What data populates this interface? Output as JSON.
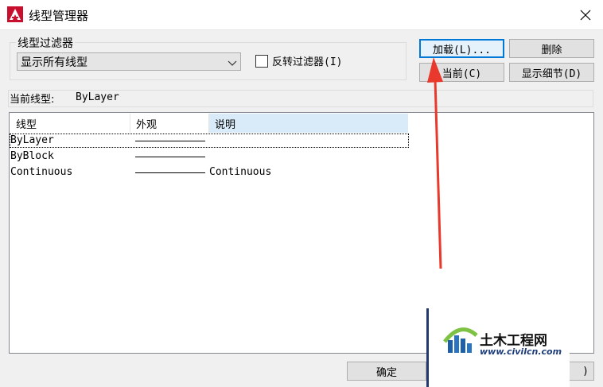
{
  "window": {
    "title": "线型管理器"
  },
  "filter": {
    "group_label": "线型过滤器",
    "selected": "显示所有线型",
    "invert_label": "反转过滤器(I)",
    "invert_checked": false
  },
  "buttons": {
    "load": "加载(L)...",
    "delete": "删除",
    "current": "当前(C)",
    "details": "显示细节(D)",
    "ok": "确定",
    "help_partial": ")"
  },
  "current_linetype": {
    "label": "当前线型:",
    "value": "ByLayer"
  },
  "table": {
    "columns": [
      "线型",
      "外观",
      "说明"
    ],
    "rows": [
      {
        "name": "ByLayer",
        "description": ""
      },
      {
        "name": "ByBlock",
        "description": ""
      },
      {
        "name": "Continuous",
        "description": "Continuous"
      }
    ]
  },
  "watermark": {
    "title": "土木工程网",
    "url": "www.civilcn.com"
  },
  "colors": {
    "accent": "#0078d7",
    "annotation_arrow": "#e8392c",
    "app_icon": "#c8102e"
  }
}
